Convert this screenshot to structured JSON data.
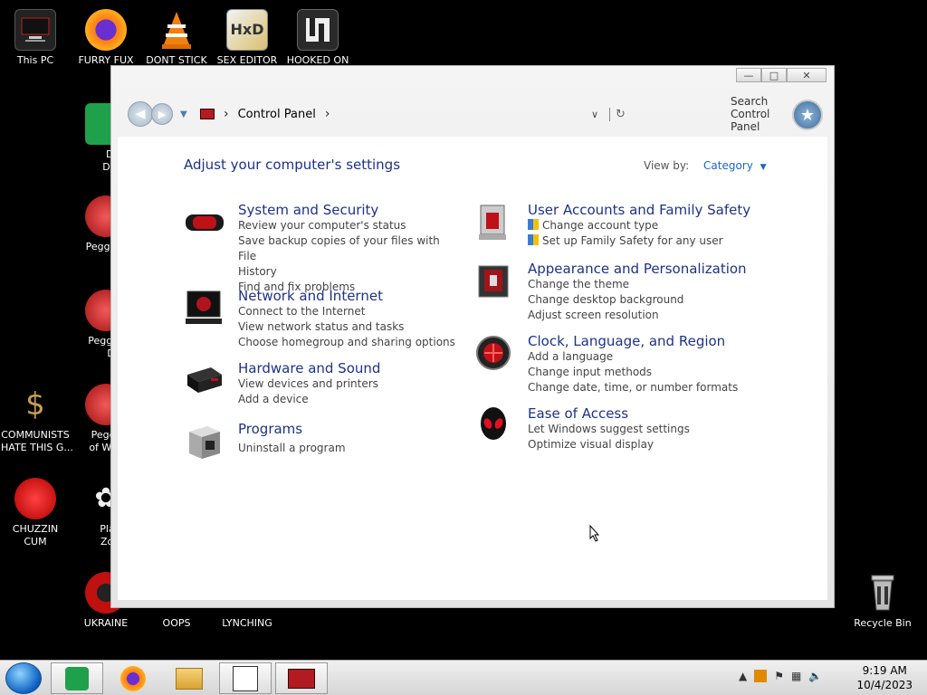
{
  "desktop": {
    "icons": [
      {
        "label": "This PC"
      },
      {
        "label": "FURRY FUX"
      },
      {
        "label": "DONT STICK"
      },
      {
        "label": "SEX EDITOR"
      },
      {
        "label": "HOOKED ON"
      },
      {
        "label": "D FC"
      },
      {
        "label": "DUMB"
      },
      {
        "label": "Peggle D"
      },
      {
        "label": "Peggle I"
      },
      {
        "label": "Delu"
      },
      {
        "label": "COMMUNISTS"
      },
      {
        "label": "HATE THIS G..."
      },
      {
        "label": "Peggle"
      },
      {
        "label": "of Warc"
      },
      {
        "label": "CHUZZIN"
      },
      {
        "label": "CUM"
      },
      {
        "label": "Plants"
      },
      {
        "label": "Zomb"
      },
      {
        "label": "UKRAINE"
      },
      {
        "label": "OOPS"
      },
      {
        "label": "LYNCHING"
      },
      {
        "label": "Recycle Bin"
      }
    ]
  },
  "window": {
    "caption": {
      "min": "—",
      "max": "□",
      "close": "✕"
    },
    "address": {
      "crumb": "Control Panel",
      "sep": "›"
    },
    "search_placeholder": "Search Control Panel",
    "heading": "Adjust your computer's settings",
    "view_by_label": "View by:",
    "view_by_value": "Category",
    "categories": [
      {
        "title": "System and Security",
        "links": [
          "Review your computer's status",
          "Save backup copies of your files with File",
          "History",
          "Find and fix problems"
        ]
      },
      {
        "title": "Network and Internet",
        "links": [
          "Connect to the Internet",
          "View network status and tasks",
          "Choose homegroup and sharing options"
        ]
      },
      {
        "title": "Hardware and Sound",
        "links": [
          "View devices and printers",
          "Add a device"
        ]
      },
      {
        "title": "Programs",
        "links": [
          "Uninstall a program"
        ]
      },
      {
        "title": "User Accounts and Family Safety",
        "links": [
          "Change account type",
          "Set up Family Safety for any user"
        ]
      },
      {
        "title": "Appearance and Personalization",
        "links": [
          "Change the theme",
          "Change desktop background",
          "Adjust screen resolution"
        ]
      },
      {
        "title": "Clock, Language, and Region",
        "links": [
          "Add a language",
          "Change input methods",
          "Change date, time, or number formats"
        ]
      },
      {
        "title": "Ease of Access",
        "links": [
          "Let Windows suggest settings",
          "Optimize visual display"
        ]
      }
    ]
  },
  "taskbar": {
    "time": "9:19 AM",
    "date": "10/4/2023"
  }
}
